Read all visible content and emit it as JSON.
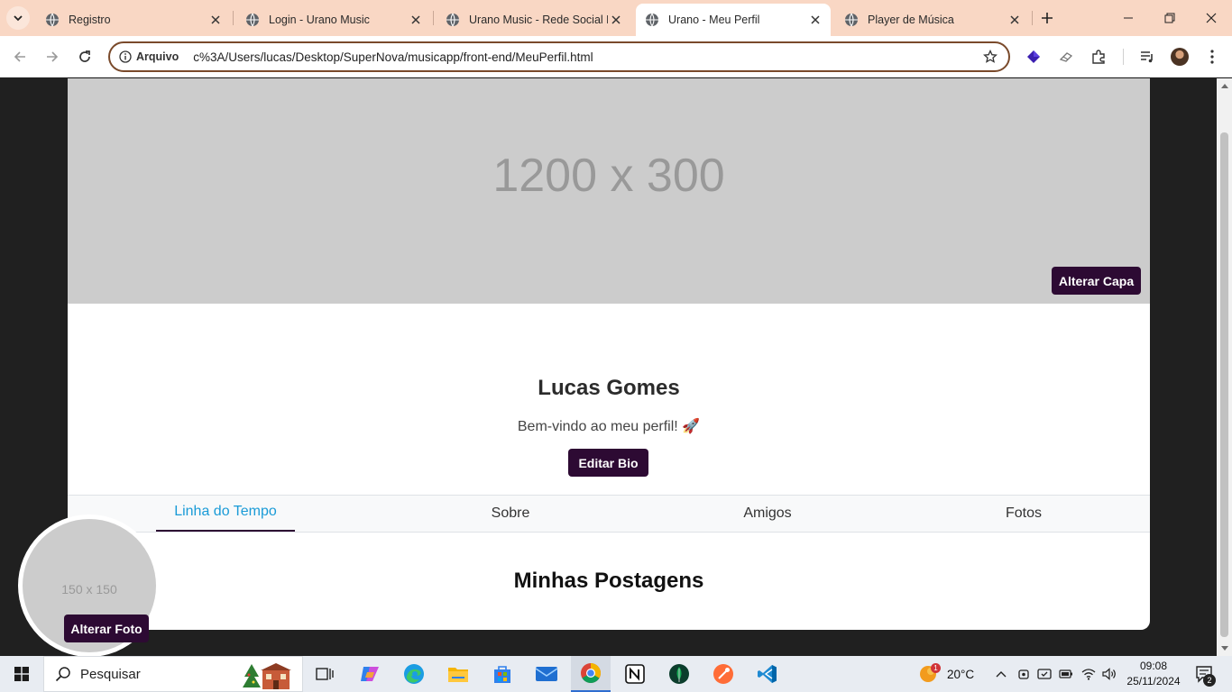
{
  "browser": {
    "tabs": [
      {
        "title": "Registro",
        "active": false
      },
      {
        "title": "Login - Urano Music",
        "active": false
      },
      {
        "title": "Urano Music - Rede Social M",
        "active": false
      },
      {
        "title": "Urano - Meu Perfil",
        "active": true
      },
      {
        "title": "Player de Música",
        "active": false
      }
    ],
    "address": {
      "chip": "Arquivo",
      "url": "c%3A/Users/lucas/Desktop/SuperNova/musicapp/front-end/MeuPerfil.html"
    }
  },
  "profile": {
    "cover_placeholder": "1200 x 300",
    "change_cover_label": "Alterar Capa",
    "name": "Lucas Gomes",
    "bio": "Bem-vindo ao meu perfil! 🚀",
    "edit_bio_label": "Editar Bio",
    "avatar_placeholder": "150 x 150",
    "change_photo_label": "Alterar Foto",
    "tabs": [
      "Linha do Tempo",
      "Sobre",
      "Amigos",
      "Fotos"
    ],
    "active_tab": "Linha do Tempo",
    "posts_title": "Minhas Postagens"
  },
  "taskbar": {
    "search_placeholder": "Pesquisar",
    "weather": {
      "temp": "20°C",
      "badge": "1"
    },
    "clock": {
      "time": "09:08",
      "date": "25/11/2024"
    },
    "notification_count": "2"
  },
  "colors": {
    "button_bg": "#2d0a33",
    "active_tab_text": "#1a9bd7",
    "tab_strip": "#f9d7c4",
    "address_border": "#7a4a2b"
  }
}
